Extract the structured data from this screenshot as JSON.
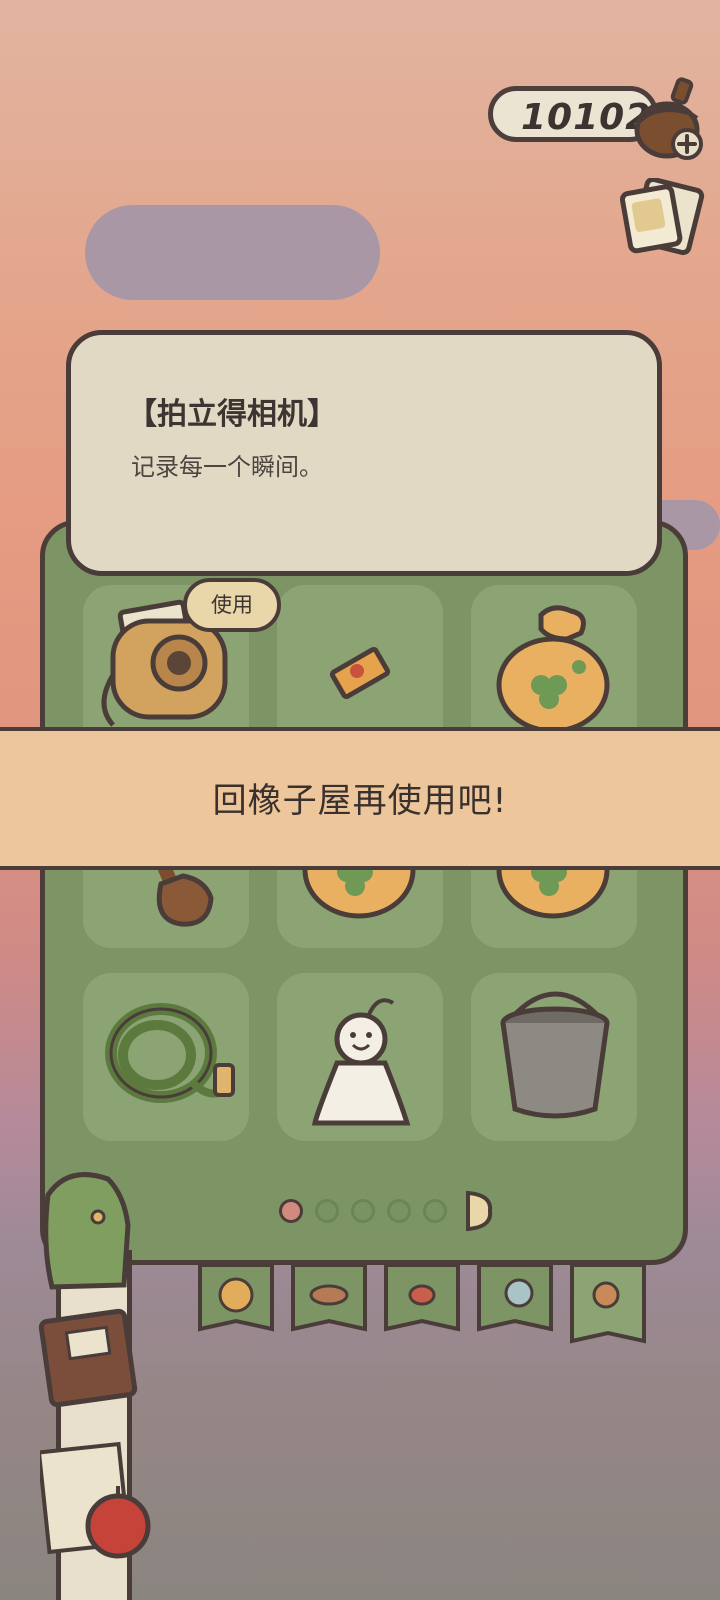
{
  "currency": {
    "value": "10102",
    "icon": "acorn-icon",
    "add_icon": "plus-icon"
  },
  "album": {
    "icon": "album-icon"
  },
  "tooltip": {
    "title": "【拍立得相机】",
    "description": "记录每一个瞬间。",
    "use_label": "使用"
  },
  "banner": {
    "text": "回橡子屋再使用吧!"
  },
  "inventory": {
    "items": [
      {
        "name": "拍立得相机",
        "icon": "instant-camera-icon",
        "selected": true
      },
      {
        "name": "",
        "icon": "ticket-icon"
      },
      {
        "name": "",
        "icon": "clover-bag-icon"
      },
      {
        "name": "",
        "icon": "shovel-icon"
      },
      {
        "name": "",
        "icon": "clover-bag-icon"
      },
      {
        "name": "",
        "icon": "clover-bag-icon"
      },
      {
        "name": "",
        "icon": "rope-icon"
      },
      {
        "name": "",
        "icon": "teru-teru-bozu-icon"
      },
      {
        "name": "",
        "icon": "bucket-icon"
      }
    ],
    "pagination": {
      "current": 1,
      "total": 5
    }
  },
  "tabs": [
    {
      "icon": "yarn-ball-icon"
    },
    {
      "icon": "leaf-icon"
    },
    {
      "icon": "candy-icon"
    },
    {
      "icon": "snail-icon"
    },
    {
      "icon": "magnifier-icon",
      "selected": true
    }
  ],
  "side": {
    "icons": [
      "backpack-icon",
      "journal-icon",
      "apple-icon"
    ]
  },
  "colors": {
    "panel": "#7d9565",
    "slot": "#8ca374",
    "banner": "#eec69b",
    "tooltip": "#e2d9c5",
    "outline": "#4a3d39"
  }
}
